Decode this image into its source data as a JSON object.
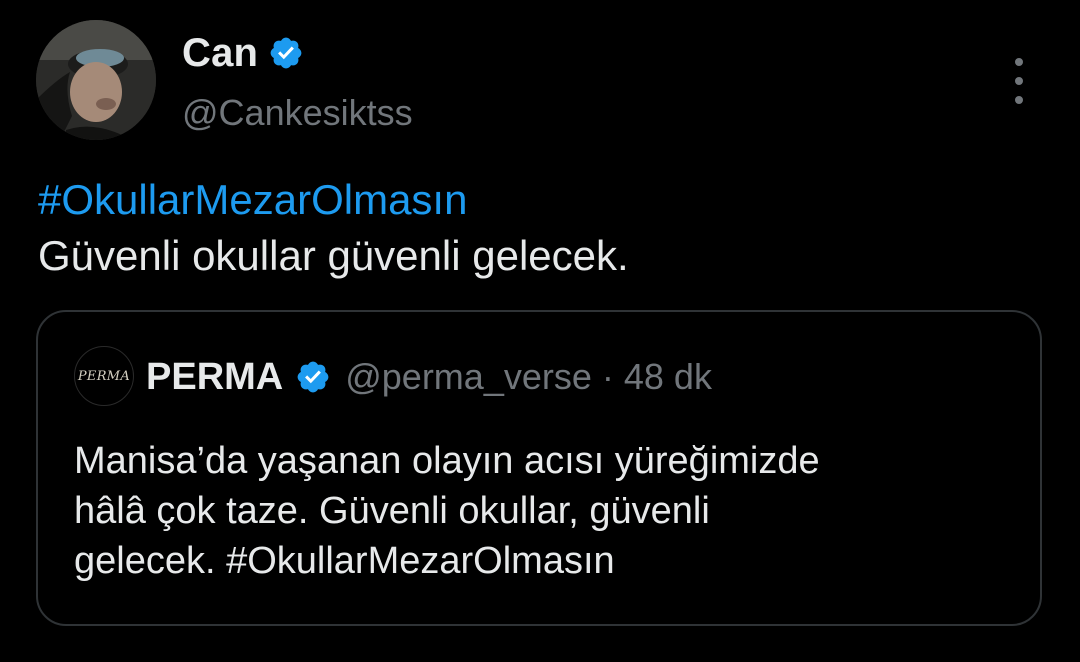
{
  "tweet": {
    "author": {
      "display_name": "Can",
      "handle": "@Cankesiktss",
      "verified": true,
      "avatar_icon": "user-photo-avatar"
    },
    "more_icon": "more-vertical-icon",
    "hashtag": "#OkullarMezarOlmasın",
    "text": "Güvenli okullar güvenli gelecek."
  },
  "quote": {
    "author": {
      "display_name": "PERMA",
      "handle": "@perma_verse",
      "verified": true,
      "logo_text": "PERMA"
    },
    "separator": "·",
    "time": "48 dk",
    "lines": [
      "Manisa’da yaşanan olayın acısı yüreğimizde",
      "hâlâ çok taze. Güvenli okullar, güvenli",
      "gelecek. #OkullarMezarOlmasın"
    ]
  },
  "colors": {
    "background": "#000000",
    "text_primary": "#e7e9ea",
    "text_secondary": "#71767b",
    "accent": "#1d9bf0",
    "border": "#2f3336"
  }
}
